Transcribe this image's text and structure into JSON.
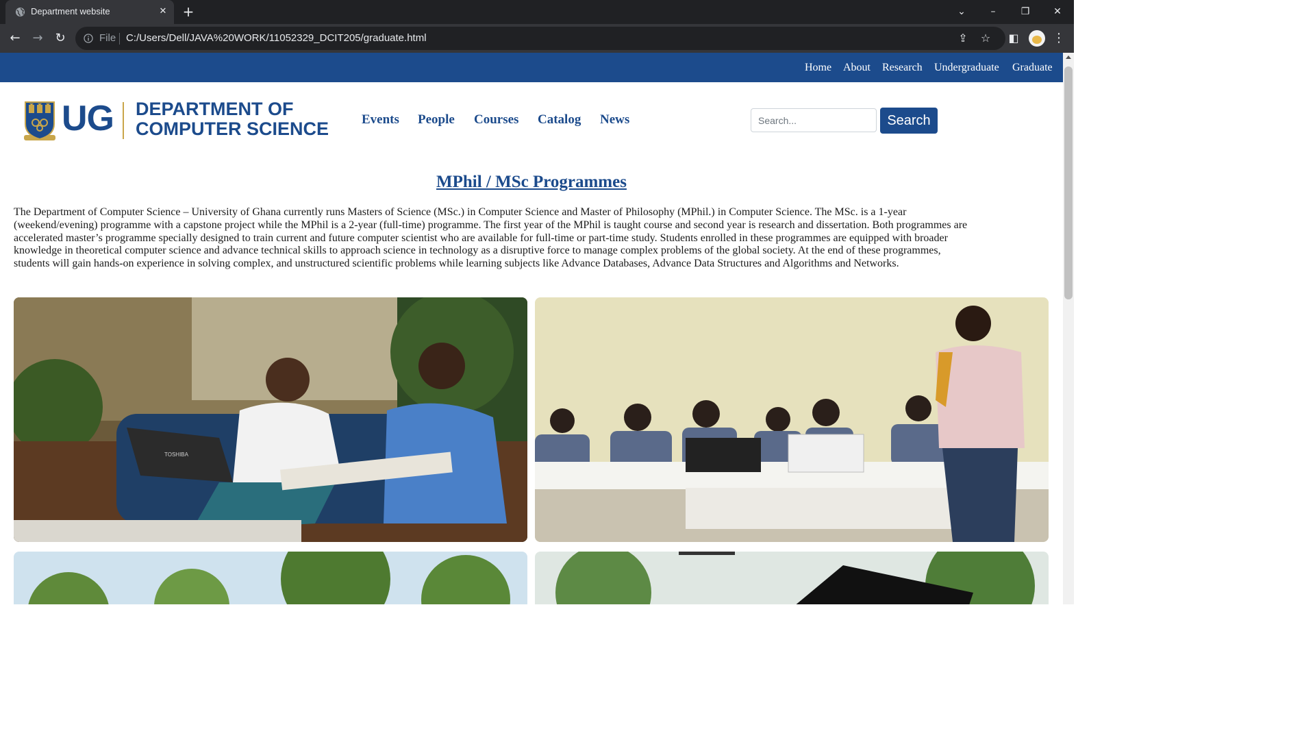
{
  "browser": {
    "tab_title": "Department website",
    "file_label": "File",
    "url": "C:/Users/Dell/JAVA%20WORK/11052329_DCIT205/graduate.html"
  },
  "topnav": {
    "items": [
      "Home",
      "About",
      "Research",
      "Undergraduate",
      "Graduate"
    ]
  },
  "logo": {
    "initials": "UG",
    "line1": "DEPARTMENT OF",
    "line2": "COMPUTER SCIENCE"
  },
  "mainnav": {
    "items": [
      "Events",
      "People",
      "Courses",
      "Catalog",
      "News"
    ]
  },
  "search": {
    "placeholder": "Search...",
    "button_label": "Search"
  },
  "content": {
    "heading": "MPhil / MSc Programmes",
    "intro": "The Department of Computer Science – University of Ghana currently runs Masters of Science (MSc.) in Computer Science and Master of Philosophy (MPhil.) in Computer Science. The MSc. is a 1-year (weekend/evening) programme with a capstone project while the MPhil is a 2-year (full-time) programme. The first year of the MPhil is taught course and second year is research and dissertation. Both programmes are accelerated master’s programme specially designed to train current and future computer scientist who are available for full-time or part-time study. Students enrolled in these programmes are equipped with broader knowledge in theoretical computer science and advance technical skills to approach science in technology as a disruptive force to manage complex problems of the global society. At the end of these programmes, students will gain hands-on experience in solving complex, and unstructured scientific problems while learning subjects like Advance Databases, Advance Data Structures and Algorithms and Networks.",
    "photo1_laptop_brand": "TOSHIBA"
  },
  "colors": {
    "brand_blue": "#1c4b8c",
    "chrome_dark": "#202124",
    "chrome_toolbar": "#35363a",
    "logo_gold": "#c9a64a"
  }
}
